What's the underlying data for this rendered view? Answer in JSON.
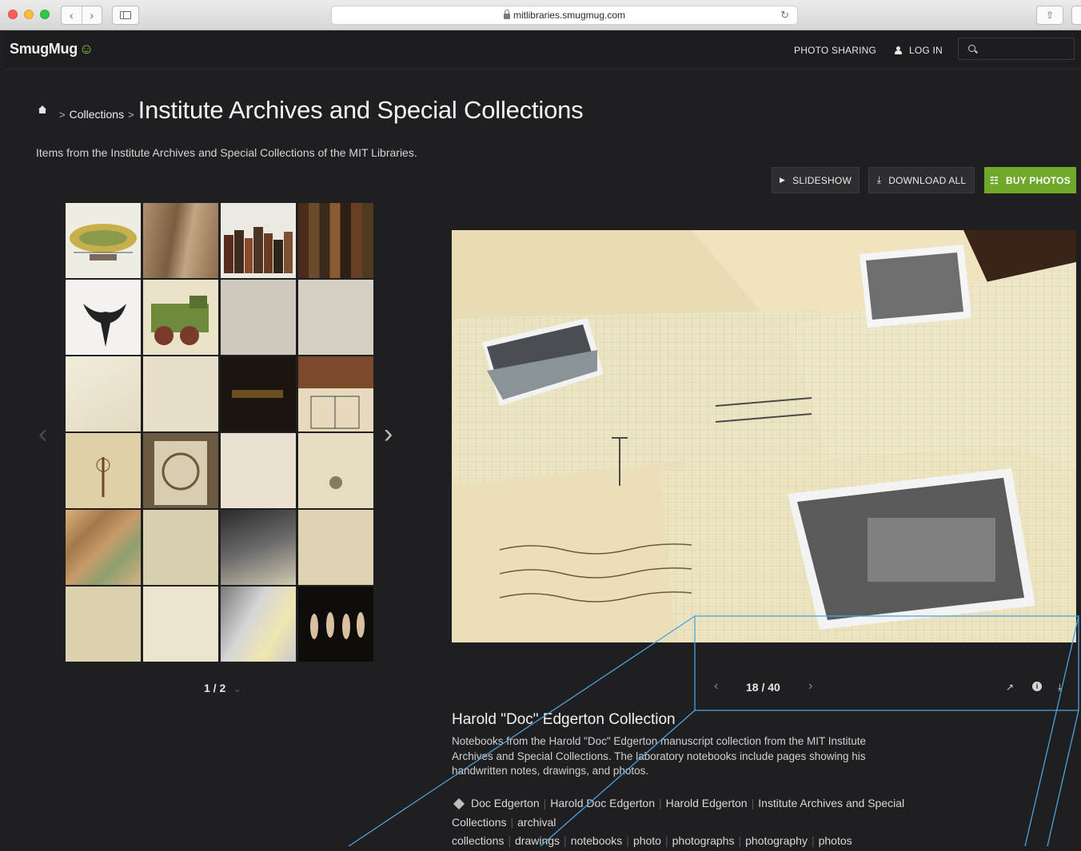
{
  "browser": {
    "url": "mitlibraries.smugmug.com",
    "back_icon": "chevron-left-icon",
    "forward_icon": "chevron-right-icon",
    "reload_icon": "reload-icon"
  },
  "header": {
    "logo": "SmugMug",
    "photo_sharing": "PHOTO SHARING",
    "login": "LOG IN",
    "search_placeholder": ""
  },
  "breadcrumb": {
    "collections": "Collections",
    "sep": ">",
    "title": "Institute Archives and Special Collections"
  },
  "description": "Items from the Institute Archives and Special Collections of the MIT Libraries.",
  "actions": {
    "slideshow": "SLIDESHOW",
    "download_all": "DOWNLOAD ALL",
    "buy_photos": "BUY PHOTOS"
  },
  "thumbnails": {
    "pager": "1 / 2",
    "count": 24
  },
  "photo": {
    "position": "18 / 40",
    "title": "Harold \"Doc\" Edgerton Collection",
    "caption": "Notebooks from the Harold \"Doc\" Edgerton manuscript collection from the MIT Institute Archives and Special Collections. The laboratory notebooks include pages showing his handwritten notes, drawings, and photos.",
    "tags": [
      "Doc Edgerton",
      "Harold Doc Edgerton",
      "Harold Edgerton",
      "Institute Archives and Special Collections",
      "archival collections",
      "drawings",
      "notebooks",
      "photo",
      "photographs",
      "photography",
      "photos"
    ]
  },
  "colors": {
    "background": "#1f1f21",
    "accent_green": "#6fa82b",
    "annotation": "#4aa3df"
  }
}
